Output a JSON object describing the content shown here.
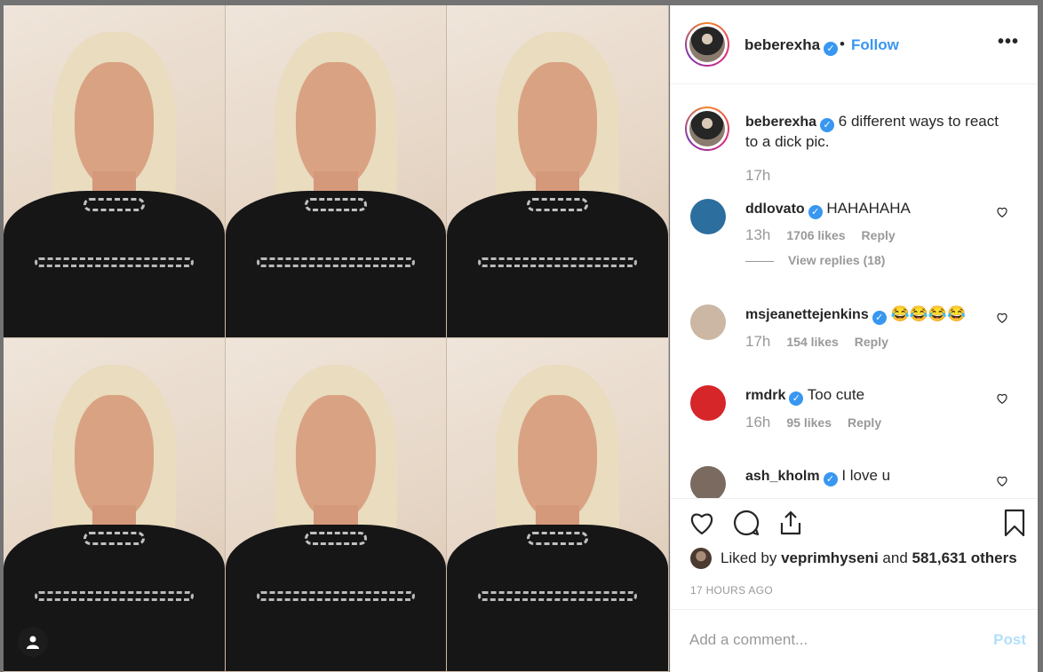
{
  "post": {
    "author": "beberexha",
    "follow_label": "Follow",
    "separator": "•",
    "more_label": "•••",
    "caption": "6 different ways to react to a dick pic.",
    "caption_time": "17h"
  },
  "comments": [
    {
      "user": "ddlovato",
      "text": "HAHAHAHA",
      "time": "13h",
      "likes": "1706 likes",
      "reply": "Reply",
      "view_replies": "View replies (18)",
      "avatar_color": "#2c6e9e"
    },
    {
      "user": "msjeanettejenkins",
      "text": "😂😂😂😂",
      "time": "17h",
      "likes": "154 likes",
      "reply": "Reply",
      "avatar_color": "#cbb7a4"
    },
    {
      "user": "rmdrk",
      "text": "Too cute",
      "time": "16h",
      "likes": "95 likes",
      "reply": "Reply",
      "avatar_color": "#d6262a"
    },
    {
      "user": "ash_kholm",
      "text": "I love u",
      "avatar_color": "#7a6a60"
    }
  ],
  "likes": {
    "prefix": "Liked by",
    "user": "veprimhyseni",
    "and": "and",
    "others": "581,631 others"
  },
  "timestamp": "17 HOURS AGO",
  "composer": {
    "placeholder": "Add a comment...",
    "post_label": "Post"
  },
  "icons": [
    "heart-icon",
    "comment-icon",
    "share-icon",
    "bookmark-icon",
    "more-icon",
    "verified-icon",
    "user-icon"
  ],
  "colors": {
    "accent": "#3897f0",
    "muted": "#999999",
    "post_disabled": "#b2dffc"
  }
}
